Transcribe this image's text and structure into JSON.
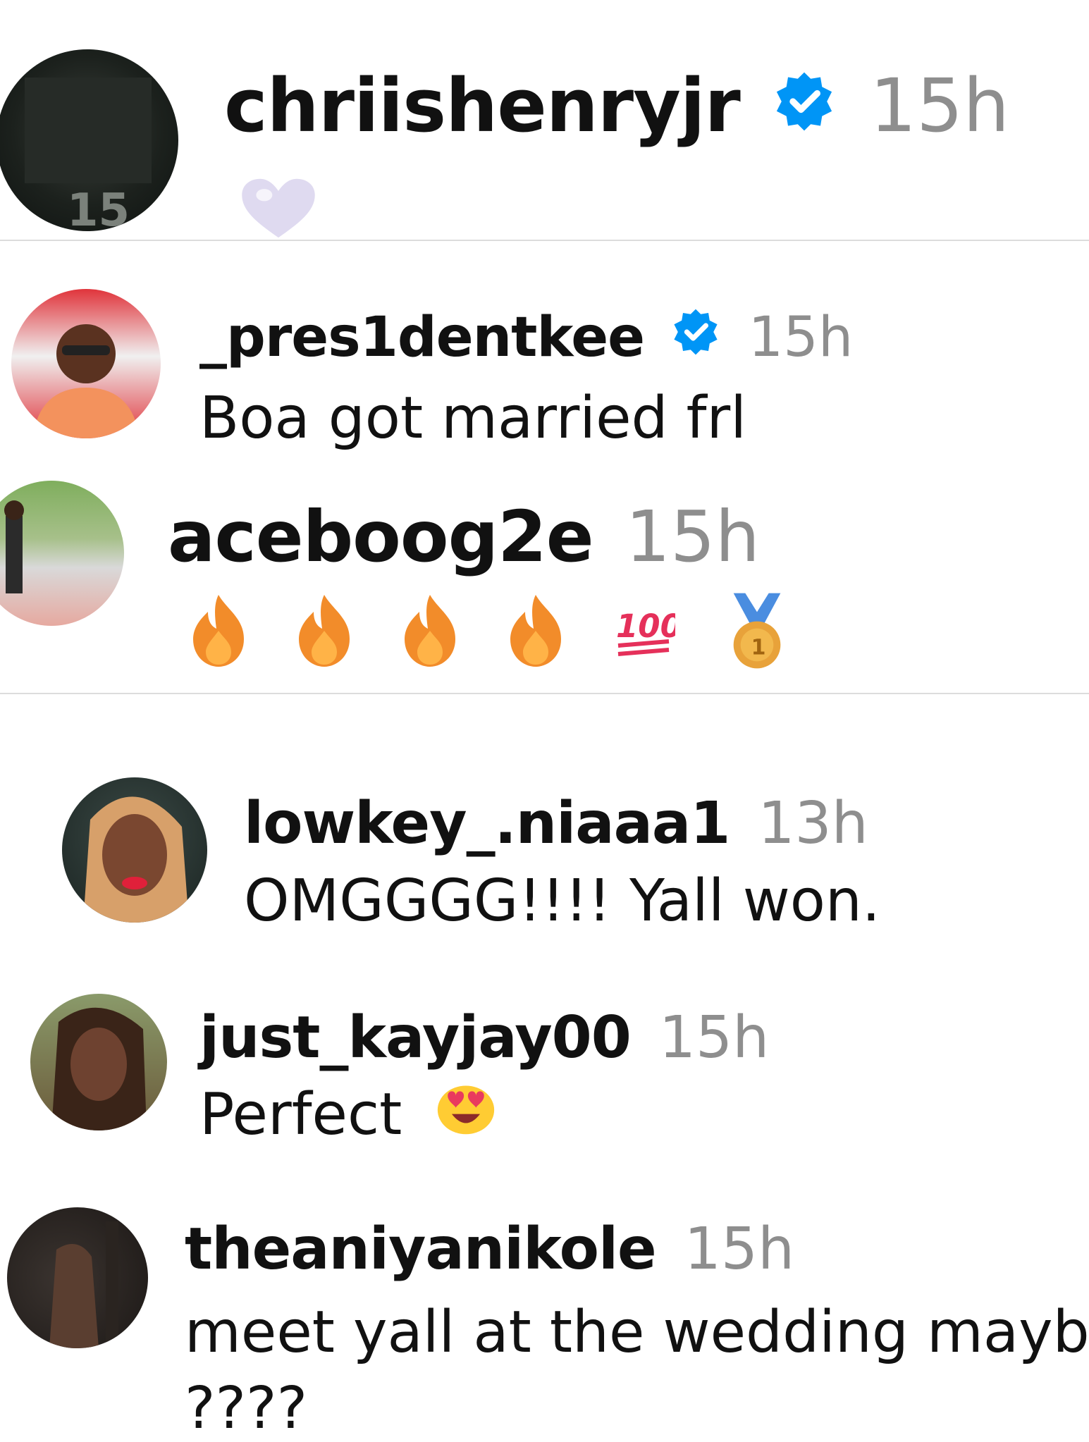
{
  "comments": [
    {
      "username": "chriishenryjr",
      "verified": true,
      "time": "15h",
      "text": "",
      "reaction_icon": "white-heart-emoji"
    },
    {
      "username": "_pres1dentkee",
      "verified": true,
      "time": "15h",
      "text": "Boa got married frl"
    },
    {
      "username": "aceboog2e",
      "verified": false,
      "time": "15h",
      "text": "",
      "emojis": [
        "fire-emoji",
        "fire-emoji",
        "fire-emoji",
        "fire-emoji",
        "hundred-points-emoji",
        "first-place-medal-emoji"
      ]
    },
    {
      "username": "lowkey_.niaaa1",
      "verified": false,
      "time": "13h",
      "text": "OMGGGG!!!! Yall won."
    },
    {
      "username": "just_kayjay00",
      "verified": false,
      "time": "15h",
      "text": "Perfect",
      "trailing_emoji": "heart-eyes-emoji"
    },
    {
      "username": "theaniyanikole",
      "verified": false,
      "time": "15h",
      "text": "meet yall at the wedding maybe",
      "text_cont": "????"
    }
  ],
  "colors": {
    "verified_badge": "#0095f6",
    "timestamp": "#8e8e8e",
    "divider": "#dcdcdc"
  }
}
